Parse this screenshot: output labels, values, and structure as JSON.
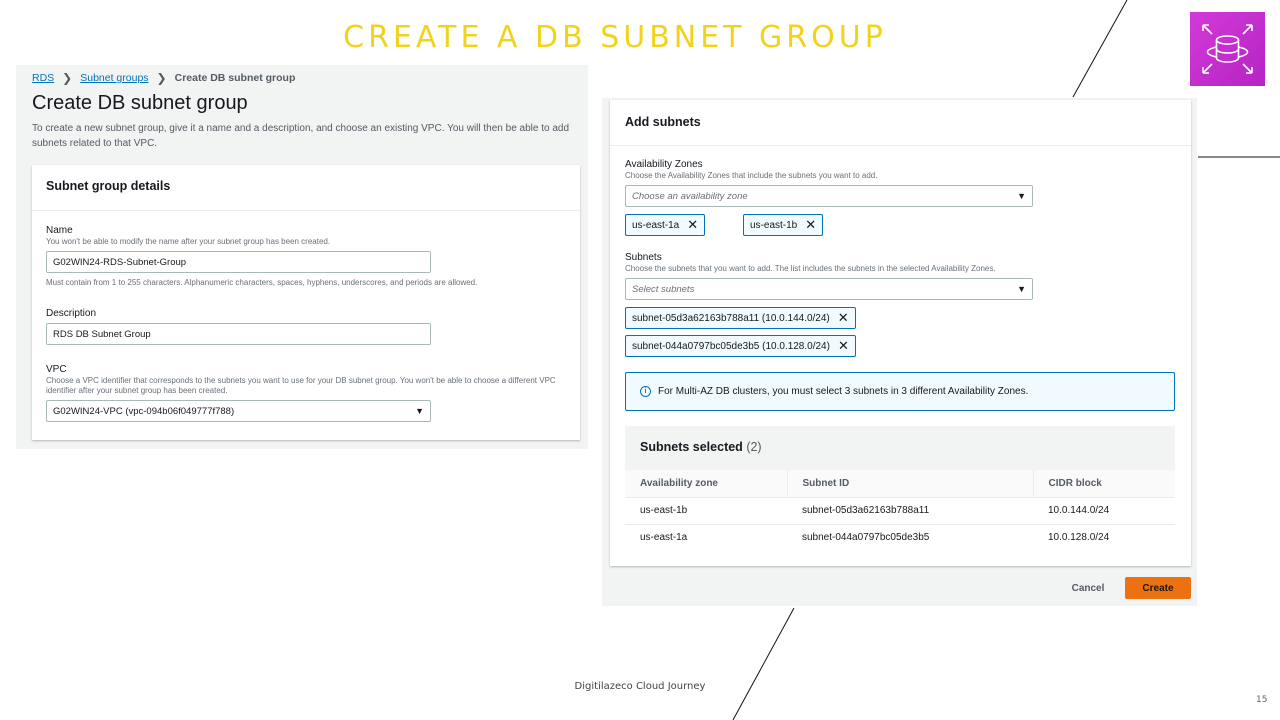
{
  "slide": {
    "title": "CREATE A DB SUBNET GROUP",
    "footer_brand": "Digitilazeco Cloud Journey",
    "page_number": "15"
  },
  "colors": {
    "title": "#f2d31b",
    "rds_logo": "#c92fd4",
    "link": "#0073bb",
    "create_button": "#ec7211"
  },
  "icons": {
    "logo": "rds-database-icon",
    "breadcrumb_sep": "chevron-right-icon",
    "dropdown": "caret-down-icon",
    "remove": "close-icon",
    "info": "info-icon"
  },
  "breadcrumb": {
    "items": [
      "RDS",
      "Subnet groups",
      "Create DB subnet group"
    ],
    "sep": "❯"
  },
  "create_page": {
    "heading": "Create DB subnet group",
    "description": "To create a new subnet group, give it a name and a description, and choose an existing VPC. You will then be able to add subnets related to that VPC."
  },
  "details": {
    "title": "Subnet group details",
    "name_label": "Name",
    "name_hint": "You won't be able to modify the name after your subnet group has been created.",
    "name_value": "G02WIN24-RDS-Subnet-Group",
    "name_constraint": "Must contain from 1 to 255 characters. Alphanumeric characters, spaces, hyphens, underscores, and periods are allowed.",
    "description_label": "Description",
    "description_value": "RDS DB Subnet Group",
    "vpc_label": "VPC",
    "vpc_hint": "Choose a VPC identifier that corresponds to the subnets you want to use for your DB subnet group. You won't be able to choose a different VPC identifier after your subnet group has been created.",
    "vpc_value": "G02WIN24-VPC (vpc-094b06f049777f788)"
  },
  "add_subnets": {
    "title": "Add subnets",
    "az_label": "Availability Zones",
    "az_hint": "Choose the Availability Zones that include the subnets you want to add.",
    "az_placeholder": "Choose an availability zone",
    "az_tokens": [
      "us-east-1a",
      "us-east-1b"
    ],
    "subnets_label": "Subnets",
    "subnets_hint": "Choose the subnets that you want to add. The list includes the subnets in the selected Availability Zones.",
    "subnets_placeholder": "Select subnets",
    "subnet_tokens": [
      "subnet-05d3a62163b788a11 (10.0.144.0/24)",
      "subnet-044a0797bc05de3b5 (10.0.128.0/24)"
    ],
    "info_text": "For Multi-AZ DB clusters, you must select 3 subnets in 3 different Availability Zones."
  },
  "selected": {
    "title": "Subnets selected",
    "count": "(2)",
    "columns": [
      "Availability zone",
      "Subnet ID",
      "CIDR block"
    ],
    "rows": [
      [
        "us-east-1b",
        "subnet-05d3a62163b788a11",
        "10.0.144.0/24"
      ],
      [
        "us-east-1a",
        "subnet-044a0797bc05de3b5",
        "10.0.128.0/24"
      ]
    ]
  },
  "actions": {
    "cancel": "Cancel",
    "create": "Create"
  }
}
